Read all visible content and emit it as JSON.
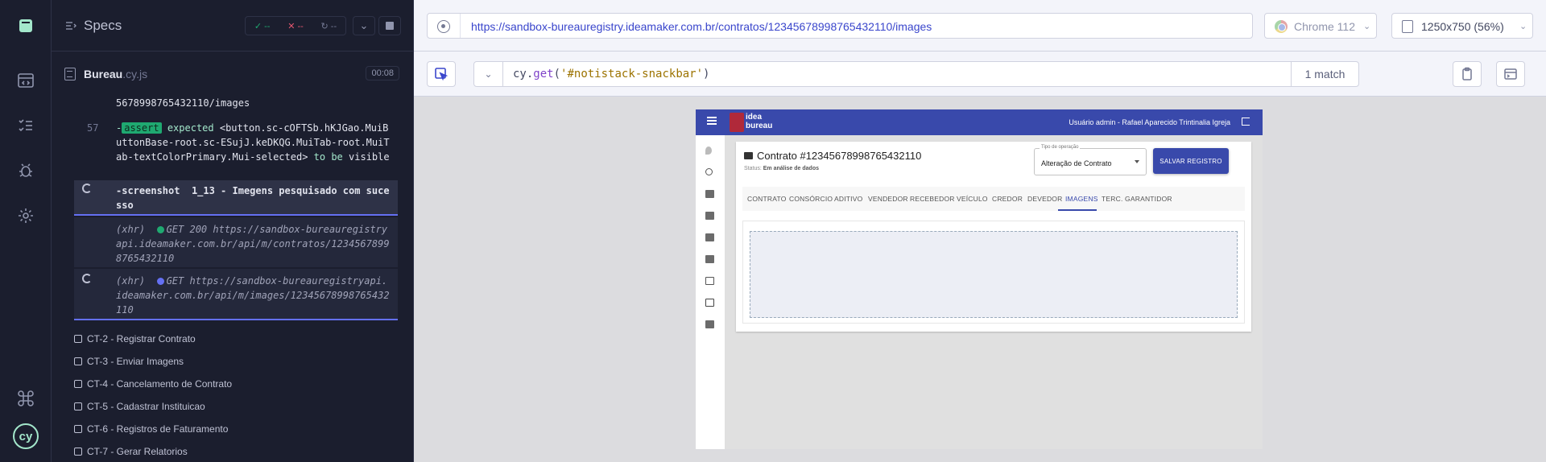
{
  "reporter": {
    "title": "Specs",
    "stats": {
      "passed": "--",
      "failed": "--",
      "pending": "--"
    },
    "spec": {
      "name": "Bureau",
      "ext": ".cy.js",
      "duration": "00:08"
    },
    "commands": [
      {
        "type": "url-tail",
        "text": "5678998765432110/images"
      },
      {
        "type": "assert",
        "num": "57",
        "badge": "assert",
        "p1": "expected",
        "p2": "<button.sc-cOFTSb.hKJGao.MuiButtonBase-root.sc-ESujJ.keDKQG.MuiTab-root.MuiTab-textColorPrimary.Mui-selected>",
        "p3": "to be",
        "p4": "visible"
      },
      {
        "type": "screenshot",
        "name": "-screenshot",
        "arg": "1_13 - Imegens pesquisado com sucesso"
      },
      {
        "type": "xhr",
        "prefix": "(xhr)",
        "status": "GET 200",
        "url": "https://sandbox-bureauregistryapi.ideamaker.com.br/api/m/contratos/12345678998765432110",
        "dot": "#1fa971"
      },
      {
        "type": "xhr",
        "prefix": "(xhr)",
        "status": "GET",
        "url": "https://sandbox-bureauregistryapi.ideamaker.com.br/api/m/images/12345678998765432110",
        "dot": "#6470f3"
      }
    ],
    "tests": [
      "CT-2 - Registrar Contrato",
      "CT-3 - Enviar Imagens",
      "CT-4 - Cancelamento de Contrato",
      "CT-5 - Cadastrar Instituicao",
      "CT-6 - Registros de Faturamento",
      "CT-7 - Gerar Relatorios"
    ]
  },
  "aut": {
    "url": "https://sandbox-bureauregistry.ideamaker.com.br/contratos/12345678998765432110/images",
    "browser": "Chrome 112",
    "viewport": "1250x750 (56%)",
    "selector": {
      "fn": "cy",
      "method": "get",
      "arg": "'#notistack-snackbar'",
      "matches": "1 match"
    }
  },
  "app": {
    "logo_line1": "idea",
    "logo_line2": "bureau",
    "user": "Usuário admin - Rafael Aparecido Trintinalia Igreja",
    "contract_title": "Contrato #12345678998765432110",
    "status_label": "Status:",
    "status_value": "Em análise de dados",
    "operation_label": "Tipo de operação",
    "operation_value": "Alteração de Contrato",
    "save_label": "SALVAR REGISTRO",
    "tabs": [
      "CONTRATO",
      "CONSÓRCIO",
      "ADITIVO",
      "VENDEDOR",
      "RECEBEDOR",
      "VEÍCULO",
      "CREDOR",
      "DEVEDOR",
      "IMAGENS",
      "TERC. GARANTIDOR"
    ],
    "selected_tab": "IMAGENS"
  },
  "colors": {
    "accent": "#3949ab",
    "cypress_accent": "#6470f3",
    "pass": "#1fa971",
    "fail": "#e45770"
  }
}
